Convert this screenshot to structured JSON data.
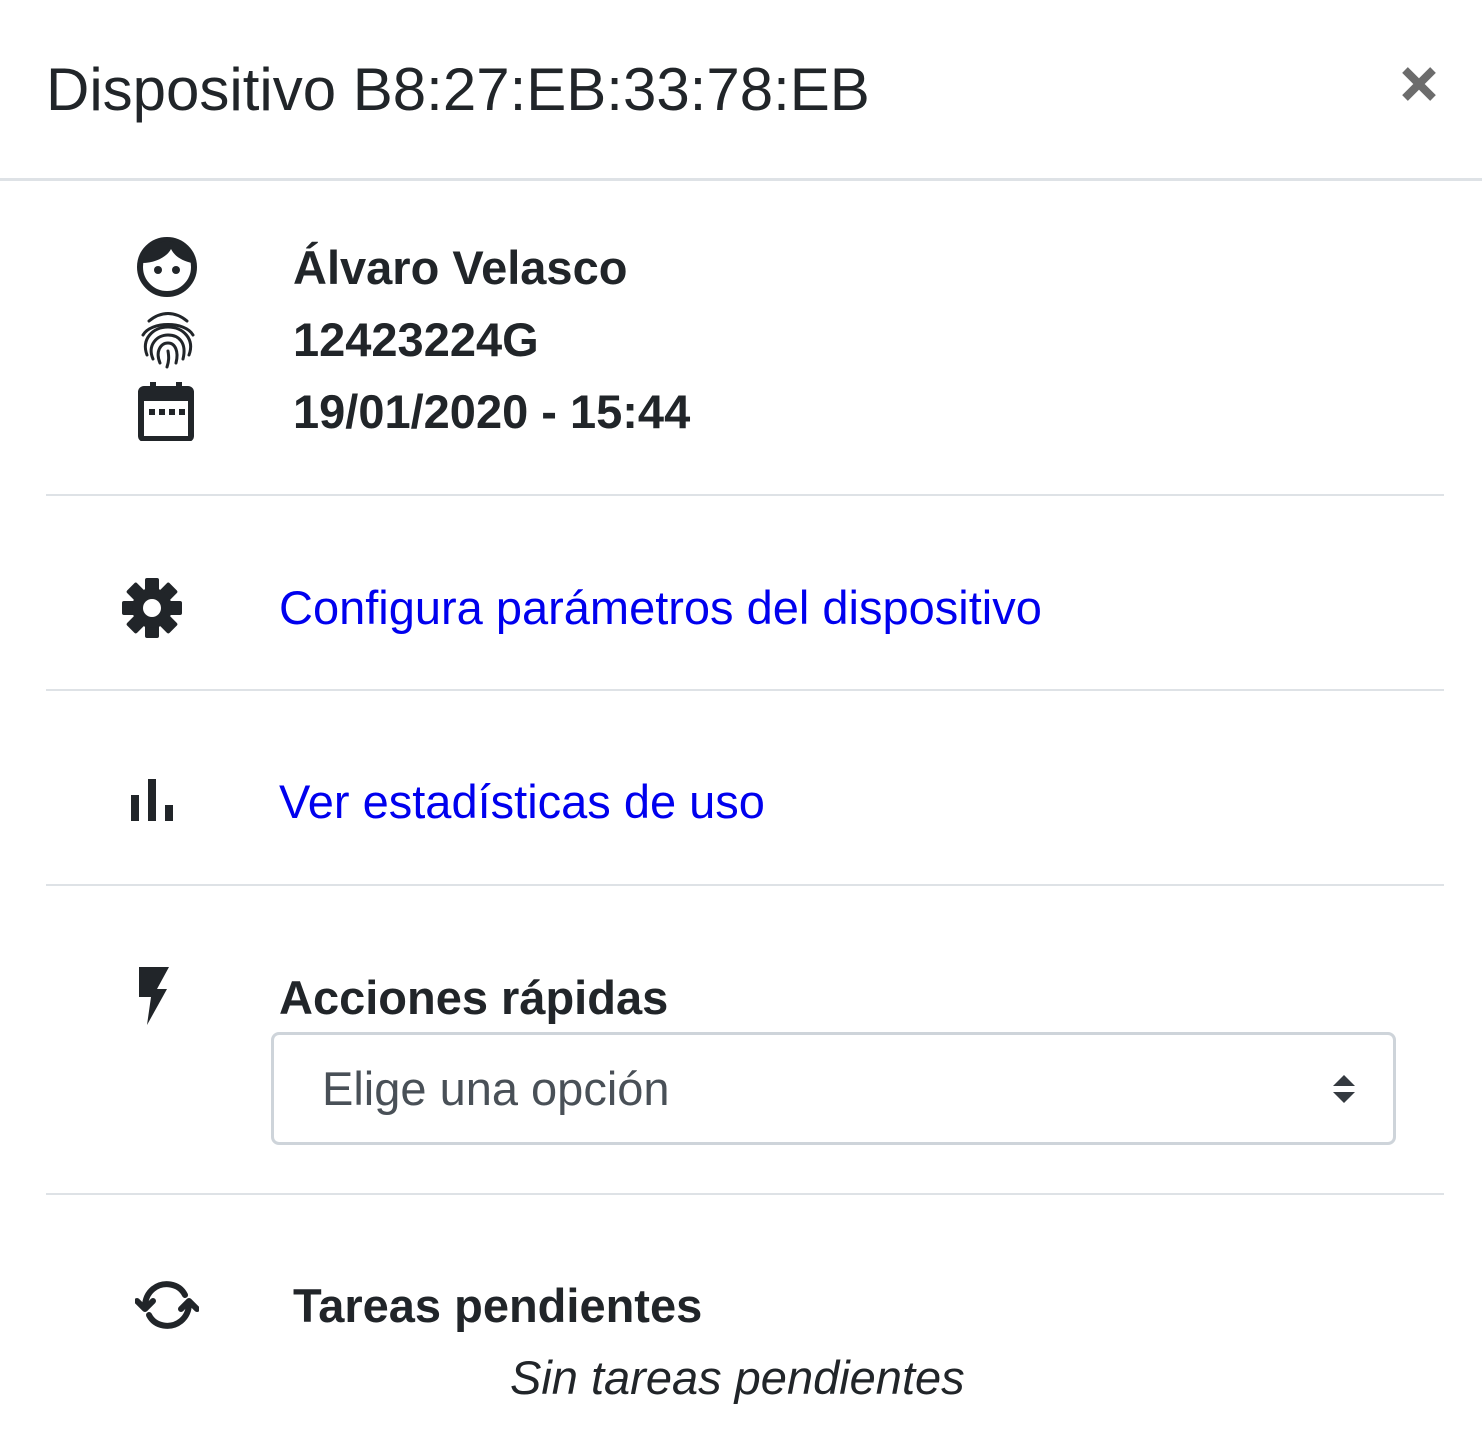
{
  "header": {
    "title": "Dispositivo B8:27:EB:33:78:EB",
    "close_icon": "close-icon"
  },
  "info": {
    "user_name": "Álvaro Velasco",
    "user_id": "12423224G",
    "datetime": "19/01/2020 - 15:44",
    "icons": [
      "face-icon",
      "fingerprint-icon",
      "calendar-icon"
    ]
  },
  "actions": {
    "configure_label": "Configura parámetros del dispositivo",
    "configure_icon": "gear-icon",
    "stats_label": "Ver estadísticas de uso",
    "stats_icon": "bar-chart-icon"
  },
  "quick_actions": {
    "title": "Acciones rápidas",
    "icon": "bolt-icon",
    "select_value": "Elige una opción"
  },
  "pending_tasks": {
    "title": "Tareas pendientes",
    "icon": "sync-icon",
    "empty_message": "Sin tareas pendientes"
  },
  "colors": {
    "link": "#0000ee",
    "text": "#212529",
    "divider": "#dee2e6",
    "select_border": "#ced4da",
    "close": "#6c6c6c"
  }
}
